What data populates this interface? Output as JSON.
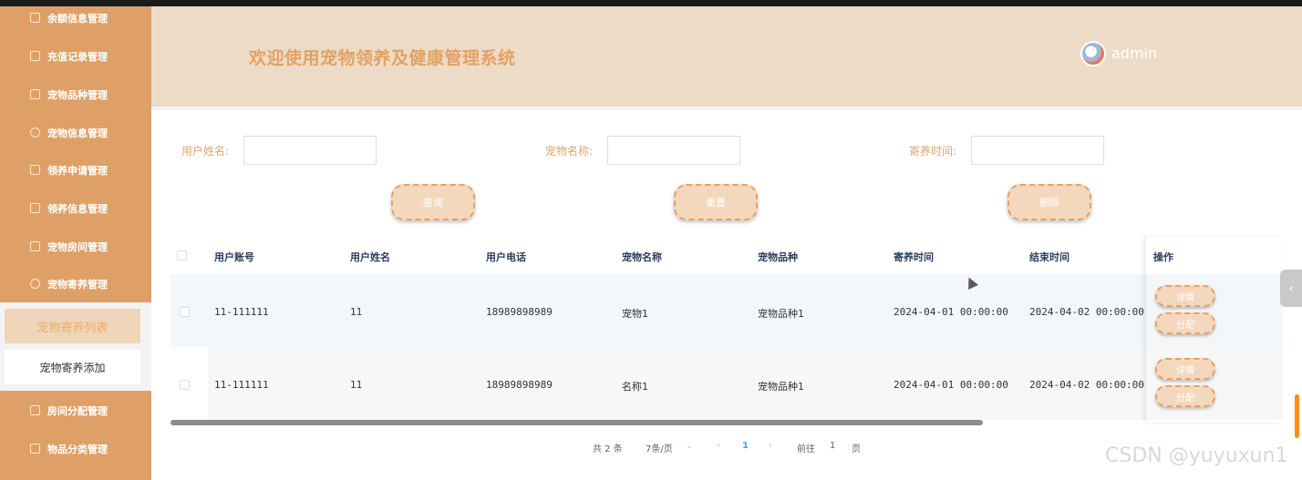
{
  "sidebar": {
    "items": [
      {
        "label": "余额信息管理",
        "icon": "edit-icon"
      },
      {
        "label": "充值记录管理",
        "icon": "chart-icon"
      },
      {
        "label": "宠物品种管理",
        "icon": "edit-icon"
      },
      {
        "label": "宠物信息管理",
        "icon": "pet-icon"
      },
      {
        "label": "领养申请管理",
        "icon": "chart-icon"
      },
      {
        "label": "领养信息管理",
        "icon": "box-icon"
      },
      {
        "label": "宠物房间管理",
        "icon": "edit-icon"
      },
      {
        "label": "宠物寄养管理",
        "icon": "pet-icon"
      },
      {
        "label": "房间分配管理",
        "icon": "edit-icon"
      },
      {
        "label": "物品分类管理",
        "icon": "box-icon"
      }
    ],
    "submenu": {
      "active": "宠物寄养列表",
      "other": "宠物寄养添加"
    }
  },
  "header": {
    "title": "欢迎使用宠物领养及健康管理系统",
    "user": "admin"
  },
  "search": {
    "user_name_label": "用户姓名:",
    "user_name_value": "",
    "pet_name_label": "宠物名称:",
    "pet_name_value": "",
    "foster_time_label": "寄养时间:",
    "foster_time_value": "",
    "query_button": "查询",
    "reset_button": "重置",
    "delete_button": "删除"
  },
  "table": {
    "columns": [
      "用户账号",
      "用户姓名",
      "用户电话",
      "宠物名称",
      "宠物品种",
      "寄养时间",
      "结束时间",
      "操作"
    ],
    "rows": [
      {
        "account": "11-111111",
        "name": "11",
        "phone": "18989898989",
        "pet_name": "宠物1",
        "breed": "宠物品种1",
        "start": "2024-04-01 00:00:00",
        "end": "2024-04-02 00:00:00"
      },
      {
        "account": "11-111111",
        "name": "11",
        "phone": "18989898989",
        "pet_name": "名称1",
        "breed": "宠物品种1",
        "start": "2024-04-01 00:00:00",
        "end": "2024-04-02 00:00:00"
      }
    ],
    "actions": {
      "detail": "详情",
      "assign": "分配"
    },
    "horizontal_scroll_fraction": 0.73
  },
  "pagination": {
    "total": "共 2 条",
    "page_size": "7条/页",
    "current_page": "1",
    "goto_label": "前往",
    "goto_value": "1",
    "page_suffix": "页"
  },
  "watermark": "CSDN @yuyuxun1",
  "colors": {
    "sidebar": "#dea067",
    "header": "#ecdbc6",
    "accent": "#e3a263",
    "page_active": "#409eff"
  }
}
